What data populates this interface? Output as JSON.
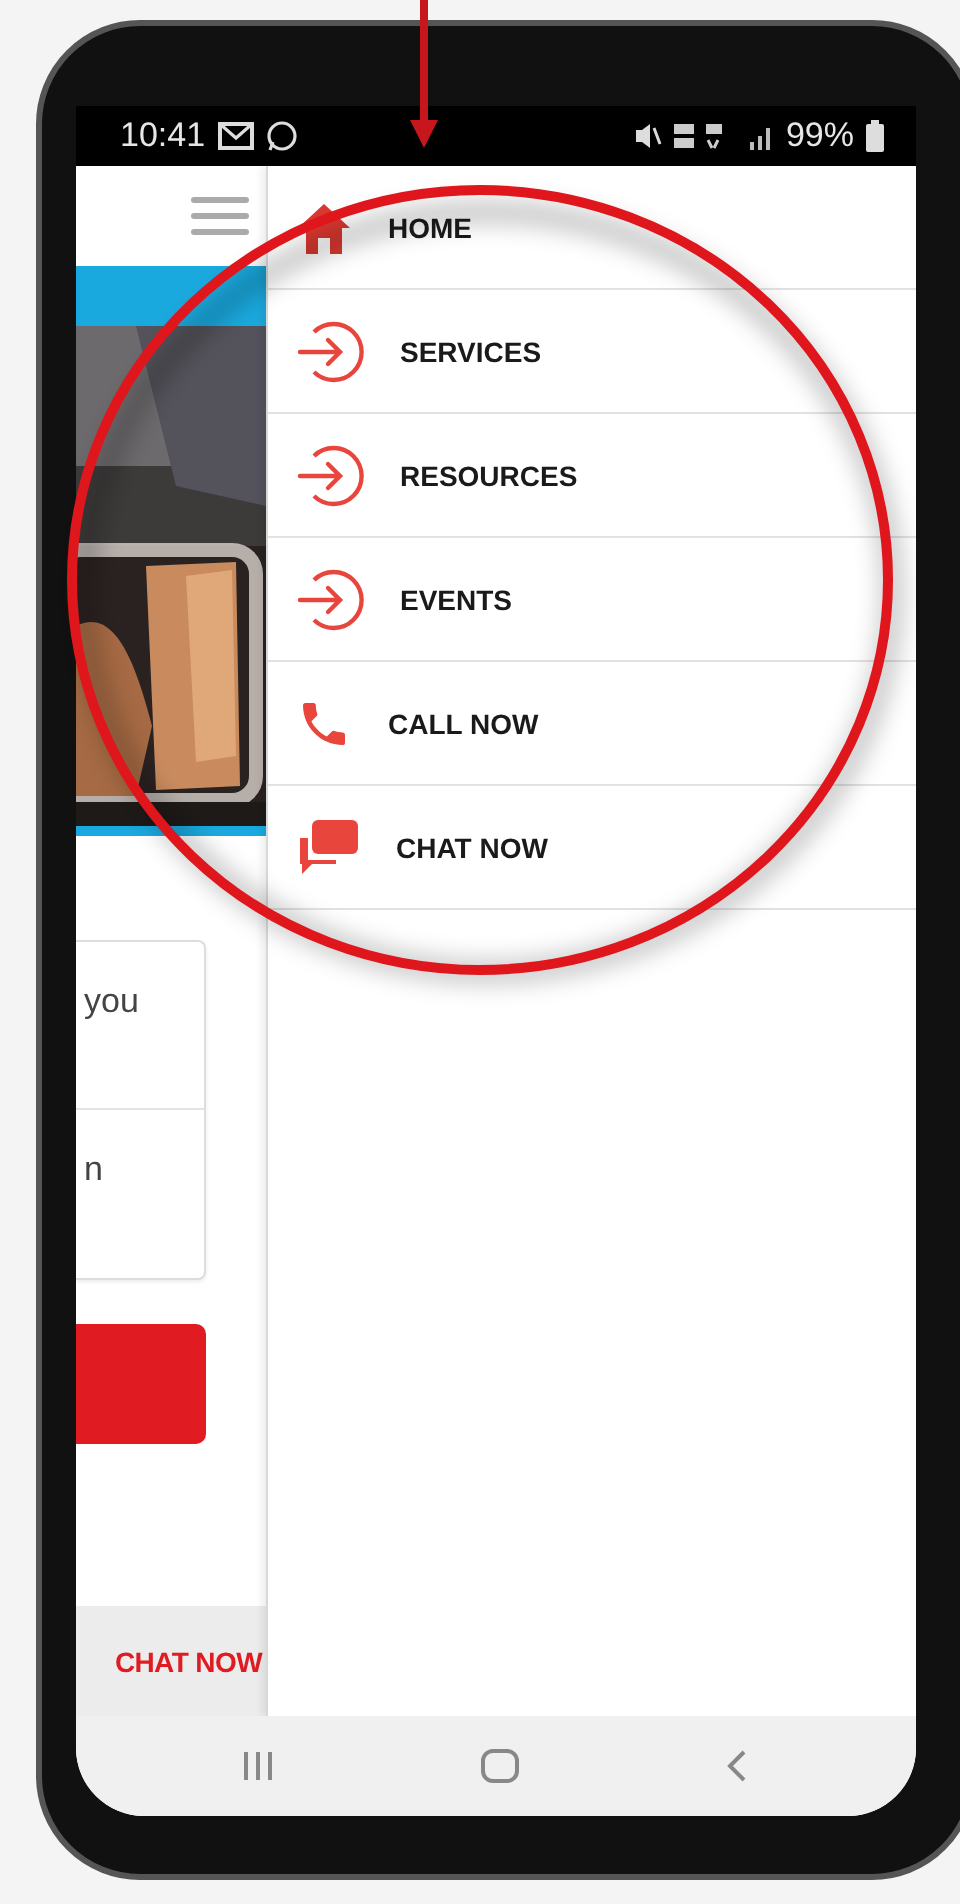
{
  "status_bar": {
    "time": "10:41",
    "battery": "99%"
  },
  "page": {
    "cards": [
      "you",
      "n"
    ],
    "footer_link": "CHAT NOW"
  },
  "drawer": {
    "items": [
      {
        "label": "HOME",
        "kind": "home"
      },
      {
        "label": "SERVICES",
        "kind": "arrow"
      },
      {
        "label": "RESOURCES",
        "kind": "arrow"
      },
      {
        "label": "EVENTS",
        "kind": "arrow"
      },
      {
        "label": "CALL NOW",
        "kind": "phone"
      },
      {
        "label": "CHAT NOW",
        "kind": "chat"
      }
    ]
  }
}
